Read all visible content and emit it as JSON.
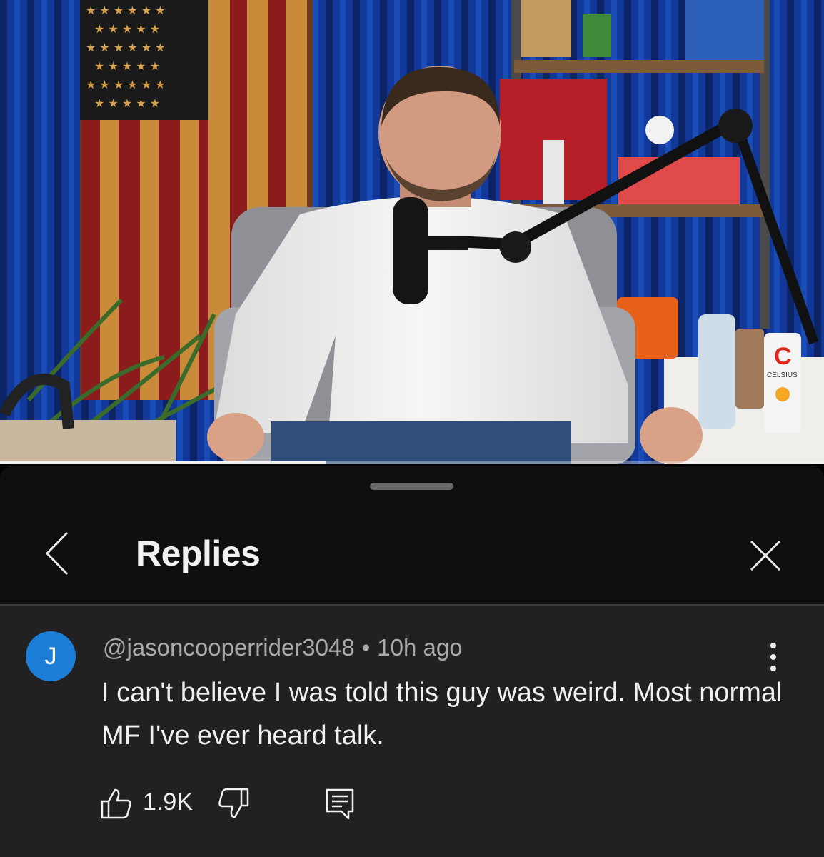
{
  "video": {
    "progress_fraction": 0.395,
    "on_screen_text": [
      "CELSIUS"
    ]
  },
  "sheet": {
    "title": "Replies"
  },
  "comment": {
    "avatar_letter": "J",
    "author": "@jasoncooperrider3048",
    "separator": "•",
    "timestamp": "10h ago",
    "text": "I can't believe I was told this guy was weird. Most normal MF I've ever heard talk.",
    "like_count": "1.9K"
  },
  "icons": {
    "back": "chevron-left-icon",
    "close": "close-icon",
    "more": "kebab-menu-icon",
    "like": "thumbs-up-icon",
    "dislike": "thumbs-down-icon",
    "reply": "reply-comment-icon"
  },
  "colors": {
    "avatar": "#1c7ed6",
    "sheet_background": "#0f0f0f",
    "comment_background": "#212121",
    "secondary_text": "#aaaaaa"
  }
}
